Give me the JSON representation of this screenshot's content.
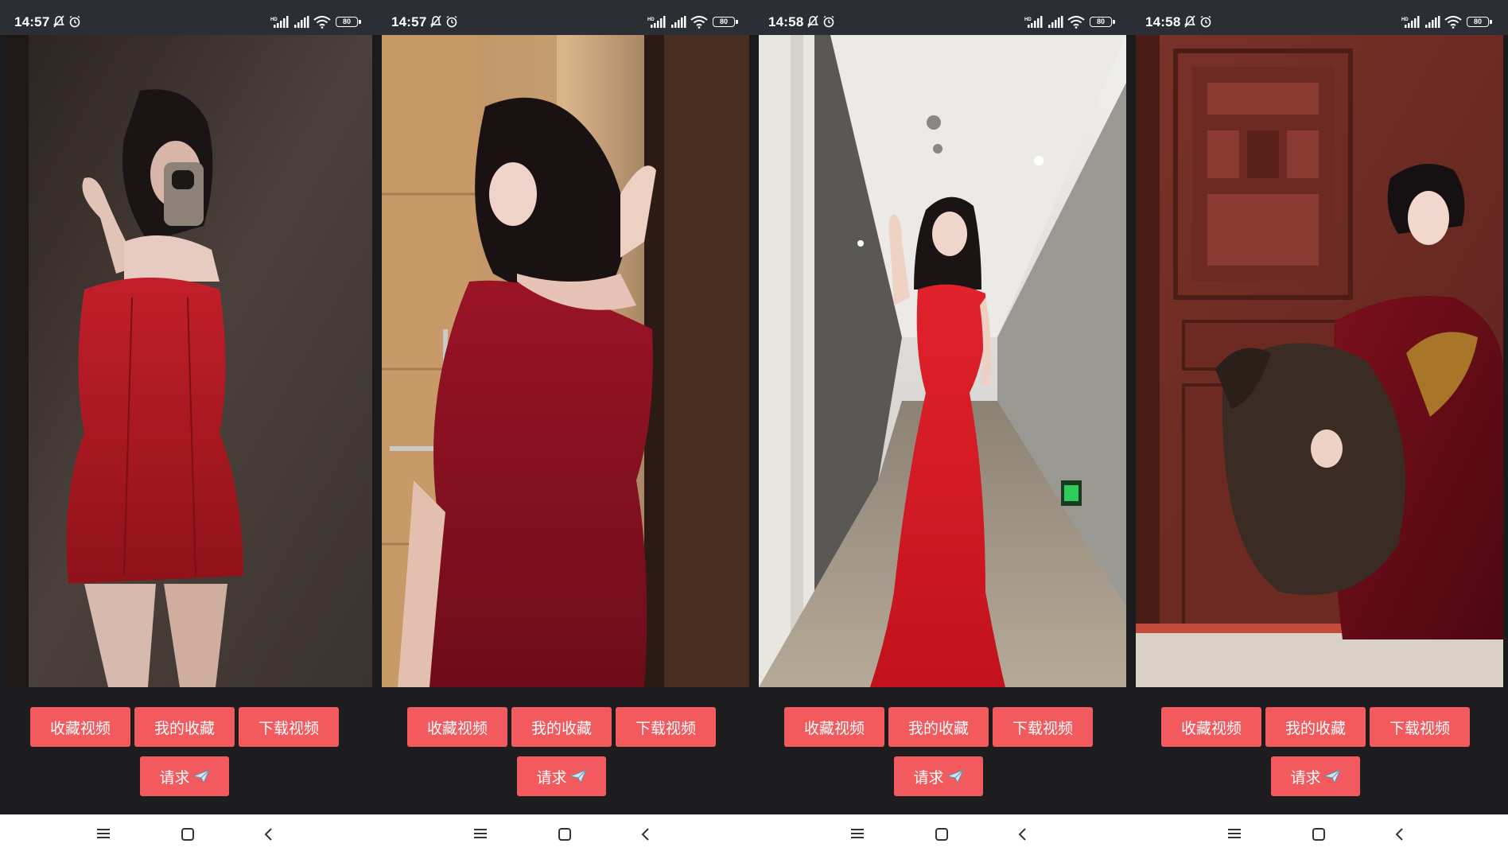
{
  "screens": [
    {
      "status": {
        "time": "14:57",
        "battery": "80"
      },
      "buttons": {
        "favorite_video": "收藏视频",
        "my_favorites": "我的收藏",
        "download_video": "下载视频",
        "request": "请求"
      }
    },
    {
      "status": {
        "time": "14:57",
        "battery": "80"
      },
      "buttons": {
        "favorite_video": "收藏视频",
        "my_favorites": "我的收藏",
        "download_video": "下载视频",
        "request": "请求"
      }
    },
    {
      "status": {
        "time": "14:58",
        "battery": "80"
      },
      "buttons": {
        "favorite_video": "收藏视频",
        "my_favorites": "我的收藏",
        "download_video": "下载视频",
        "request": "请求"
      }
    },
    {
      "status": {
        "time": "14:58",
        "battery": "80"
      },
      "buttons": {
        "favorite_video": "收藏视频",
        "my_favorites": "我的收藏",
        "download_video": "下载视频",
        "request": "请求"
      }
    }
  ],
  "icons": {
    "status_bar": [
      "bell-muted-icon",
      "alarm-icon",
      "hd-signal-icon",
      "signal-icon",
      "wifi-icon",
      "battery-icon"
    ],
    "request_button": "airplane-emoji-icon",
    "nav_bar": [
      "menu-icon",
      "home-icon",
      "back-icon"
    ]
  },
  "colors": {
    "status_bar_bg": "#2c2e36",
    "button_bg": "#f25a5e",
    "button_text": "#ffffff",
    "controls_bg": "#1d1d20",
    "nav_bar_bg": "#ffffff"
  }
}
